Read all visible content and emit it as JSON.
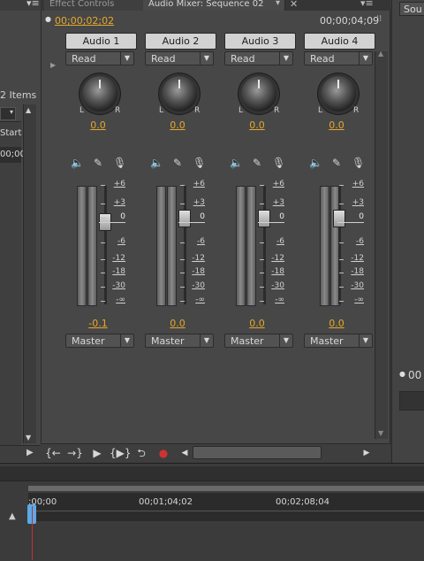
{
  "left_panel": {
    "items_label": "2 Items",
    "column_header": "Start",
    "timecode_cell": "00;00"
  },
  "tabs": [
    {
      "label": "Effect Controls"
    },
    {
      "label": "Audio Mixer: Sequence 02"
    }
  ],
  "mixer": {
    "current_time": "00;00;02;02",
    "total_time": "00;00;04;09",
    "tracks": [
      {
        "name": "Audio 1",
        "automation": "Read",
        "pan_value": "0.0",
        "volume_value": "-0.1",
        "output": "Master"
      },
      {
        "name": "Audio 2",
        "automation": "Read",
        "pan_value": "0.0",
        "volume_value": "0.0",
        "output": "Master"
      },
      {
        "name": "Audio 3",
        "automation": "Read",
        "pan_value": "0.0",
        "volume_value": "0.0",
        "output": "Master"
      },
      {
        "name": "Audio 4",
        "automation": "Read",
        "pan_value": "0.0",
        "volume_value": "0.0",
        "output": "Master"
      }
    ],
    "pan_left": "L",
    "pan_right": "R",
    "scale": [
      "+6",
      "+3",
      "0",
      "-6",
      "-12",
      "-18",
      "-30",
      "-∞"
    ]
  },
  "right_panel": {
    "tab_label": "Sou",
    "timecode": "00"
  },
  "timeline": {
    "ruler_labels": [
      ";00;00",
      "00;01;04;02",
      "00;02;08;04"
    ]
  },
  "colors": {
    "accent_timecode": "#e7a82a",
    "playhead": "#c23030",
    "playhead_head": "#5aa9e8"
  }
}
